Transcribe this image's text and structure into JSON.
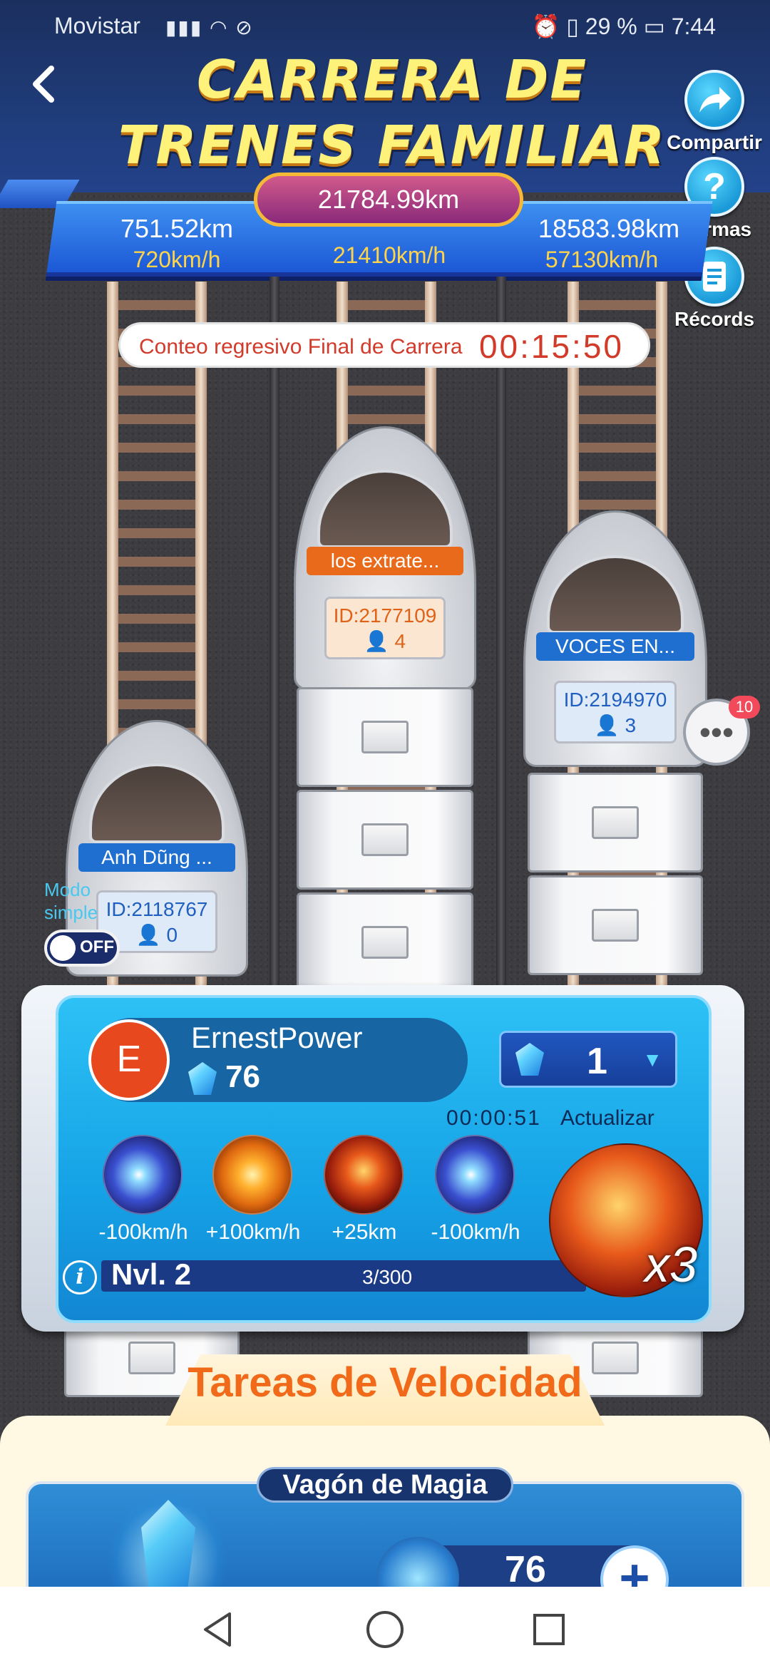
{
  "status_bar": {
    "carrier": "Movistar",
    "battery": "29 %",
    "time": "7:44"
  },
  "header": {
    "title_line1": "CARRERA DE",
    "title_line2": "TRENES FAMILIAR"
  },
  "side_buttons": {
    "share": "Compartir",
    "rules": "Normas",
    "records": "Récords"
  },
  "scoreboard": {
    "leader_distance": "21784.99km",
    "leader_speed": "21410km/h",
    "left_distance": "751.52km",
    "left_speed": "720km/h",
    "right_distance": "18583.98km",
    "right_speed": "57130km/h"
  },
  "countdown": {
    "label": "Conteo regresivo Final de Carrera",
    "time": "00:15:50"
  },
  "trains": [
    {
      "name": "Anh Dũng ...",
      "id": "ID:2118767",
      "members": "0",
      "plate_color": "#1f6fd1"
    },
    {
      "name": "los extrate...",
      "id": "ID:2177109",
      "members": "4",
      "plate_color": "#e86a1a"
    },
    {
      "name": "VOCES EN...",
      "id": "ID:2194970",
      "members": "3",
      "plate_color": "#1f6fd1"
    }
  ],
  "chat": {
    "badge": "10"
  },
  "simple_mode": {
    "label_line1": "Modo",
    "label_line2": "simple",
    "toggle": "OFF"
  },
  "player": {
    "avatar_letter": "E",
    "username": "ErnestPower",
    "gems": "76",
    "selected_quantity": "1",
    "timer": "00:00:51",
    "update_label": "Actualizar",
    "skills": [
      {
        "icon": "lightning-blue-icon",
        "effect": "-100km/h"
      },
      {
        "icon": "fire-burst-icon",
        "effect": "+100km/h"
      },
      {
        "icon": "fire-vortex-icon",
        "effect": "+25km"
      },
      {
        "icon": "lightning-blue-icon",
        "effect": "-100km/h"
      }
    ],
    "featured_multiplier": "x3",
    "level": "Nvl. 2",
    "level_progress": "3/300"
  },
  "tasks": {
    "title": "Tareas de Velocidad",
    "card_title": "Vagón de Magia",
    "card_count": "76"
  }
}
